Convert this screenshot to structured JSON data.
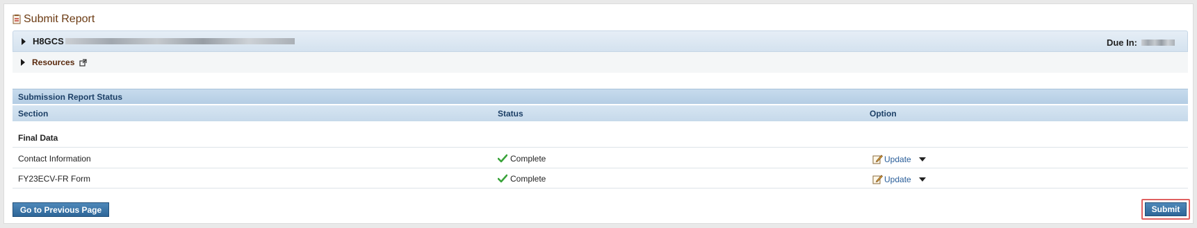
{
  "page": {
    "title": "Submit Report"
  },
  "grant": {
    "id_prefix": "H8GCS",
    "due_label": "Due In:"
  },
  "resources": {
    "label": "Resources"
  },
  "table": {
    "title": "Submission Report Status",
    "columns": [
      "Section",
      "Status",
      "Option"
    ],
    "group": "Final Data",
    "rows": [
      {
        "section": "Contact Information",
        "status": "Complete",
        "option": "Update"
      },
      {
        "section": "FY23ECV-FR Form",
        "status": "Complete",
        "option": "Update"
      }
    ]
  },
  "buttons": {
    "previous": "Go to Previous Page",
    "submit": "Submit"
  },
  "colors": {
    "title": "#6b3a12",
    "header_blue": "#1c3f66",
    "button": "#2d6698",
    "status_check": "#3aa33a",
    "link": "#2a5e99",
    "highlight": "#e06060"
  },
  "icons": {
    "title": "report-icon",
    "external": "external-link-icon",
    "status": "check-icon",
    "edit": "pencil-icon",
    "dropdown": "chevron-down-icon"
  }
}
